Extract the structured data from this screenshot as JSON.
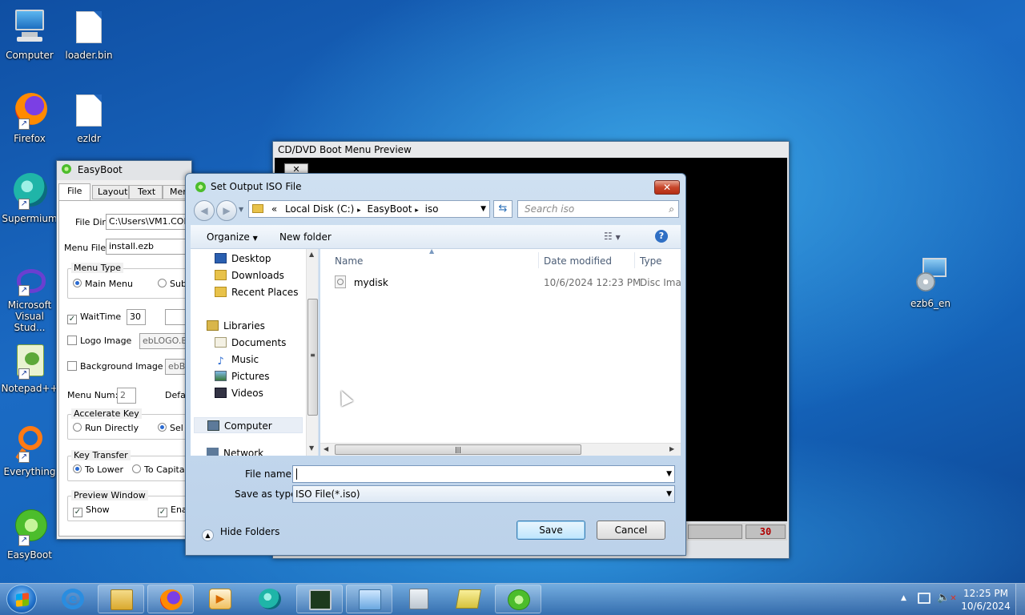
{
  "desktop": {
    "icons": [
      {
        "label": "Computer",
        "icon": "computer-icon"
      },
      {
        "label": "loader.bin",
        "icon": "file-icon"
      },
      {
        "label": "Firefox",
        "icon": "firefox-icon"
      },
      {
        "label": "ezldr",
        "icon": "file-icon"
      },
      {
        "label": "Supermium",
        "icon": "supermium-icon"
      },
      {
        "label": "Microsoft Visual Stud...",
        "icon": "visual-studio-icon"
      },
      {
        "label": "Notepad++",
        "icon": "notepadpp-icon"
      },
      {
        "label": "Everything",
        "icon": "everything-icon"
      },
      {
        "label": "EasyBoot",
        "icon": "easyboot-icon"
      },
      {
        "label": "ezb6_en",
        "icon": "installer-icon"
      }
    ]
  },
  "easyboot": {
    "title": "EasyBoot",
    "tabs": [
      "File",
      "Layout",
      "Text",
      "Men"
    ],
    "file_dir_label": "File Dir:",
    "file_dir_value": "C:\\Users\\VM1.COLL",
    "menu_file_label": "Menu File:",
    "menu_file_value": "install.ezb",
    "menu_type": {
      "title": "Menu Type",
      "main": "Main Menu",
      "sub": "Sub"
    },
    "waittime_label": "WaitTime",
    "waittime_value": "30",
    "logo_label": "Logo Image",
    "logo_value": "ebLOGO.BI",
    "bg_label": "Background Image",
    "bg_value": "ebBA",
    "menu_num_label": "Menu Num:",
    "menu_num_value": "2",
    "default_label": "Defa",
    "accel": {
      "title": "Accelerate Key",
      "run": "Run Directly",
      "sel": "Sel"
    },
    "key_transfer": {
      "title": "Key Transfer",
      "lower": "To Lower",
      "capital": "To Capital"
    },
    "preview": {
      "title": "Preview Window",
      "show": "Show",
      "ena": "Ena"
    }
  },
  "preview_window": {
    "title": "CD/DVD Boot Menu Preview",
    "counter": "30"
  },
  "dialog": {
    "title": "Set Output ISO File",
    "path": [
      "«",
      "Local Disk (C:)",
      "EasyBoot",
      "iso"
    ],
    "search_placeholder": "Search iso",
    "organize": "Organize",
    "new_folder": "New folder",
    "nav": {
      "favorites": [
        "Desktop",
        "Downloads",
        "Recent Places"
      ],
      "libraries": "Libraries",
      "library_items": [
        "Documents",
        "Music",
        "Pictures",
        "Videos"
      ],
      "computer": "Computer",
      "network": "Network"
    },
    "columns": {
      "name": "Name",
      "date": "Date modified",
      "type": "Type"
    },
    "files": [
      {
        "name": "mydisk",
        "date": "10/6/2024 12:23 PM",
        "type": "Disc Imag"
      }
    ],
    "file_name_label": "File name:",
    "file_name_value": "",
    "save_type_label": "Save as type:",
    "save_type_value": "ISO File(*.iso)",
    "hide_folders": "Hide Folders",
    "save": "Save",
    "cancel": "Cancel"
  },
  "taskbar": {
    "apps": [
      "internet-explorer-icon",
      "file-explorer-icon",
      "firefox-icon",
      "media-player-icon",
      "supermium-icon",
      "task-manager-icon",
      "control-panel-icon",
      "calculator-icon",
      "folders-icon",
      "easyboot-icon"
    ],
    "time": "12:25 PM",
    "date": "10/6/2024"
  }
}
